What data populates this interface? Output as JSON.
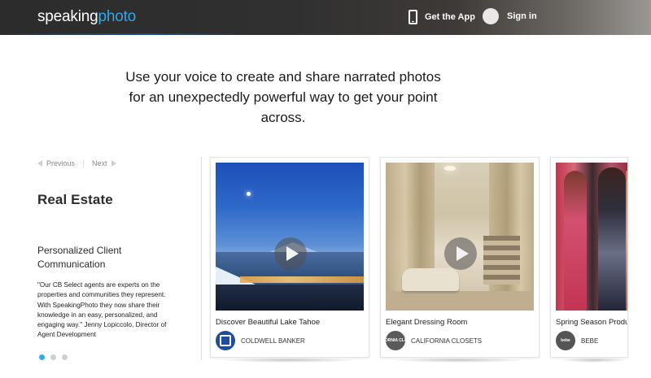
{
  "header": {
    "logo_part1": "speaking",
    "logo_part2": "photo",
    "get_app_label": "Get the App",
    "sign_in_label": "Sign in"
  },
  "tagline": "Use your voice to create and share narrated photos for an unexpectedly powerful way to get your point across.",
  "sidebar": {
    "previous_label": "Previous",
    "next_label": "Next",
    "category": "Real Estate",
    "subheading": "Personalized Client Communication",
    "quote": "\"Our CB Select agents are experts on the properties and communities they represent. With SpeakingPhoto they now share their knowledge in an easy, personalized, and engaging way.\" Jenny Lopiccolo, Director of Agent Development",
    "pagination": {
      "total": 3,
      "active_index": 0
    }
  },
  "cards": [
    {
      "title": "Discover Beautiful Lake Tahoe",
      "brand": "COLDWELL BANKER",
      "brand_logo_text": "",
      "has_play": true
    },
    {
      "title": "Elegant Dressing Room",
      "brand": "CALIFORNIA CLOSETS",
      "brand_logo_text": "CALIFORNIA CLOSETS",
      "has_play": true
    },
    {
      "title": "Spring Season Produ",
      "brand": "BEBE",
      "brand_logo_text": "bebe",
      "has_play": false
    }
  ],
  "colors": {
    "accent": "#31a7e6",
    "active_dot": "#3ba7e3",
    "coldwell_blue": "#1f4d9c"
  },
  "icons": [
    "phone-icon",
    "avatar-icon",
    "previous-arrow-icon",
    "next-arrow-icon",
    "play-icon"
  ]
}
